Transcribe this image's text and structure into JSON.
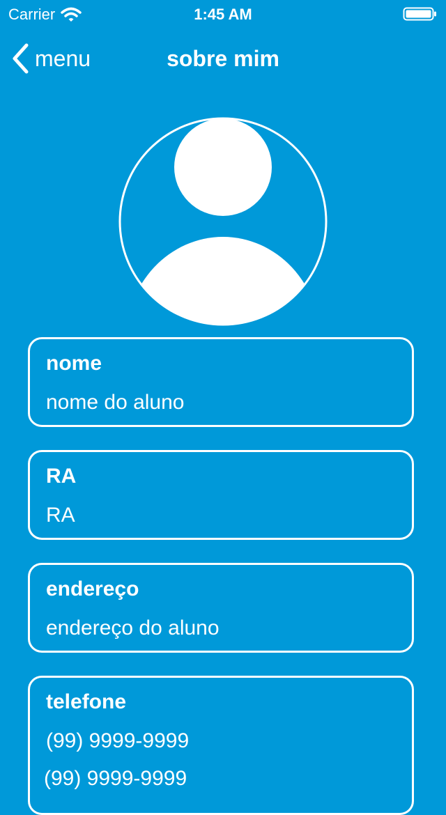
{
  "status_bar": {
    "carrier": "Carrier",
    "time": "1:45 AM"
  },
  "nav": {
    "back_label": "menu",
    "title": "sobre mim"
  },
  "fields": {
    "nome": {
      "label": "nome",
      "value": "nome do aluno"
    },
    "ra": {
      "label": "RA",
      "value": "RA"
    },
    "endereco": {
      "label": "endereço",
      "value": "endereço do aluno"
    },
    "telefone": {
      "label": "telefone",
      "value": "(99) 9999-9999",
      "value2": "(99) 9999-9999"
    }
  },
  "colors": {
    "background": "#0099D9",
    "foreground": "#FFFFFF"
  },
  "icons": {
    "back": "chevron-left-icon",
    "avatar": "user-placeholder-icon",
    "wifi": "wifi-icon",
    "battery": "battery-icon"
  }
}
